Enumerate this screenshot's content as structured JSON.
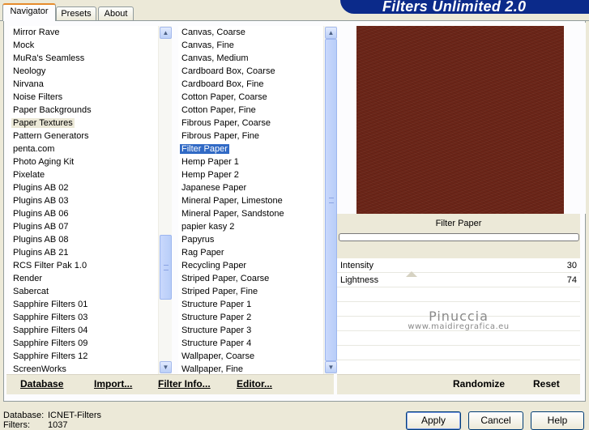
{
  "tabs": [
    {
      "label": "Navigator",
      "active": true
    },
    {
      "label": "Presets",
      "active": false
    },
    {
      "label": "About",
      "active": false
    }
  ],
  "banner": {
    "title": "Filters Unlimited 2.0"
  },
  "categories": {
    "items": [
      "Mirror Rave",
      "Mock",
      "MuRa's Seamless",
      "Neology",
      "Nirvana",
      "Noise Filters",
      "Paper Backgrounds",
      "Paper Textures",
      "Pattern Generators",
      "penta.com",
      "Photo Aging Kit",
      "Pixelate",
      "Plugins AB 02",
      "Plugins AB 03",
      "Plugins AB 06",
      "Plugins AB 07",
      "Plugins AB 08",
      "Plugins AB 21",
      "RCS Filter Pak 1.0",
      "Render",
      "Sabercat",
      "Sapphire Filters 01",
      "Sapphire Filters 03",
      "Sapphire Filters 04",
      "Sapphire Filters 09",
      "Sapphire Filters 12",
      "ScreenWorks"
    ],
    "selected": "Paper Textures"
  },
  "filters": {
    "items": [
      "Canvas, Coarse",
      "Canvas, Fine",
      "Canvas, Medium",
      "Cardboard Box, Coarse",
      "Cardboard Box, Fine",
      "Cotton Paper, Coarse",
      "Cotton Paper, Fine",
      "Fibrous Paper, Coarse",
      "Fibrous Paper, Fine",
      "Filter Paper",
      "Hemp Paper 1",
      "Hemp Paper 2",
      "Japanese Paper",
      "Mineral Paper, Limestone",
      "Mineral Paper, Sandstone",
      "papier kasy 2",
      "Papyrus",
      "Rag Paper",
      "Recycling Paper",
      "Striped Paper, Coarse",
      "Striped Paper, Fine",
      "Structure Paper 1",
      "Structure Paper 2",
      "Structure Paper 3",
      "Structure Paper 4",
      "Wallpaper, Coarse",
      "Wallpaper, Fine"
    ],
    "selected": "Filter Paper"
  },
  "preview": {
    "color": "#6b2518"
  },
  "filter_name": "Filter Paper",
  "progress": 0,
  "sliders": [
    {
      "label": "Intensity",
      "value": "30",
      "level": 30
    },
    {
      "label": "Lightness",
      "value": "74",
      "level": 74
    }
  ],
  "watermark": {
    "line1": "Pinuccia",
    "line2": "www.maidiregrafica.eu"
  },
  "left_links": [
    "Database",
    "Import...",
    "Filter Info...",
    "Editor..."
  ],
  "right_links": [
    "Randomize",
    "Reset"
  ],
  "status": {
    "database_label": "Database:",
    "database_value": "ICNET-Filters",
    "filters_label": "Filters:",
    "filters_value": "1037"
  },
  "buttons": {
    "apply": "Apply",
    "cancel": "Cancel",
    "help": "Help"
  }
}
